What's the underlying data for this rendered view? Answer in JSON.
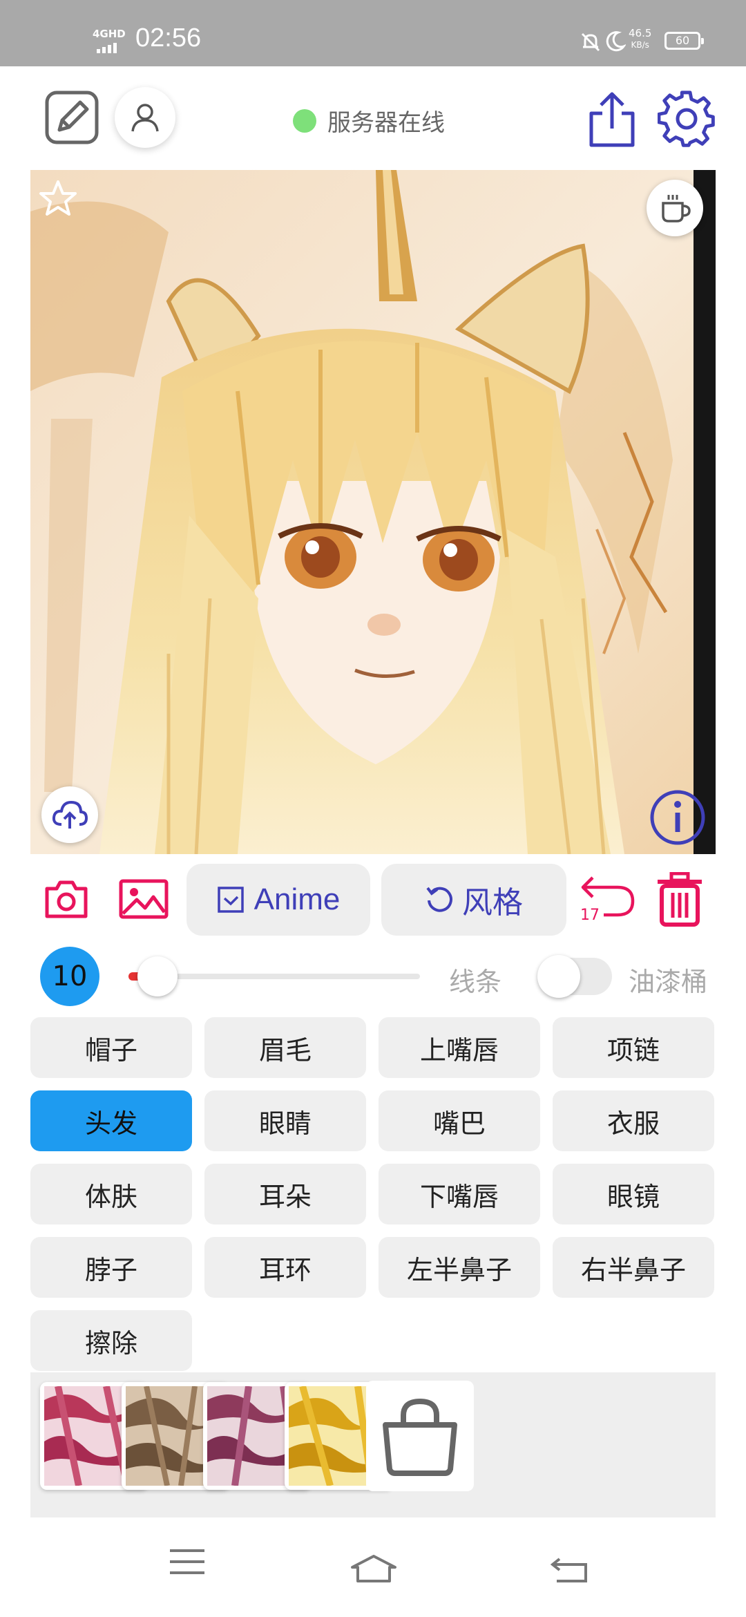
{
  "status_bar": {
    "network": "4GHD",
    "time": "02:56",
    "speed_value": "46.5",
    "speed_unit": "KB/s",
    "battery": "60"
  },
  "header": {
    "server_status": "服务器在线",
    "status_color": "#7ee07a",
    "icons": [
      "edit-icon",
      "user-icon",
      "share-icon",
      "gear-icon"
    ]
  },
  "canvas": {
    "overlay_icons": [
      "star-icon",
      "coffee-icon",
      "cloud-upload-icon",
      "info-icon"
    ]
  },
  "toolbar": {
    "camera_icon": "camera-icon",
    "gallery_icon": "image-icon",
    "model_label": "Anime",
    "style_label": "风格",
    "undo_count": "17",
    "accent_color": "#e8145c",
    "button_text_color": "#3f3fb8"
  },
  "brush": {
    "size": "10",
    "slider_value": 0.1,
    "line_label": "线条",
    "fill_label": "油漆桶",
    "fill_enabled": false
  },
  "parts": {
    "items": [
      "帽子",
      "眉毛",
      "上嘴唇",
      "项链",
      "头发",
      "眼睛",
      "嘴巴",
      "衣服",
      "体肤",
      "耳朵",
      "下嘴唇",
      "眼镜",
      "脖子",
      "耳环",
      "左半鼻子",
      "右半鼻子",
      "擦除"
    ],
    "selected": "头发",
    "selected_color": "#1e9bf0"
  },
  "textures": {
    "count": 4,
    "more_icon": "shopping-bag-icon"
  },
  "nav_bar": {
    "icons": [
      "menu-icon",
      "home-icon",
      "back-icon"
    ]
  }
}
